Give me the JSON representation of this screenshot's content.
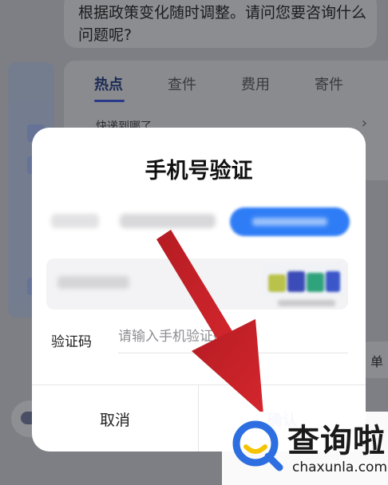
{
  "chat": {
    "text": "根据政策变化随时调整。请问您要咨询什么问题呢?"
  },
  "tabs": [
    {
      "label": "热点",
      "active": true
    },
    {
      "label": "查件",
      "active": false
    },
    {
      "label": "费用",
      "active": false
    },
    {
      "label": "寄件",
      "active": false
    }
  ],
  "hot_item": "快递到哪了",
  "right_chip": "单",
  "dialog": {
    "title": "手机号验证",
    "verify_label": "验证码",
    "verify_placeholder": "请输入手机验证码",
    "cancel_label": "取消",
    "confirm_label": "确认"
  },
  "watermark": {
    "brand": "查询啦",
    "url": "chaxunla.com"
  },
  "colors": {
    "overlay": "#7d7f84",
    "confirm": "#1a4fd6",
    "arrow": "#c8222a",
    "watermark_blue": "#2d6fe0",
    "watermark_yellow": "#f5c400"
  }
}
